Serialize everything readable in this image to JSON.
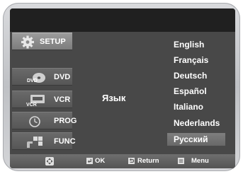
{
  "menu": {
    "items": [
      {
        "label": "SETUP",
        "icon": "gear-icon"
      },
      {
        "label": "DVD",
        "icon": "dvd-disc-icon"
      },
      {
        "label": "VCR",
        "icon": "vcr-icon"
      },
      {
        "label": "PROG",
        "icon": "clock-icon"
      },
      {
        "label": "FUNC",
        "icon": "function-grid-icon"
      }
    ],
    "active_index": 0
  },
  "setting": {
    "label": "Язык"
  },
  "languages": {
    "options": [
      "English",
      "Français",
      "Deutsch",
      "Español",
      "Italiano",
      "Nederlands",
      "Русский"
    ],
    "selected_index": 6
  },
  "bottom_bar": {
    "nav_icon": "directional-pad-icon",
    "ok_label": "OK",
    "ok_icon": "enter-icon",
    "return_label": "Return",
    "return_icon": "return-icon",
    "menu_label": "Menu",
    "menu_icon": "menu-icon"
  },
  "colors": {
    "screen_bg": "#484848",
    "top_band": "#202020",
    "text": "#ffffff",
    "selection": "#747474"
  }
}
